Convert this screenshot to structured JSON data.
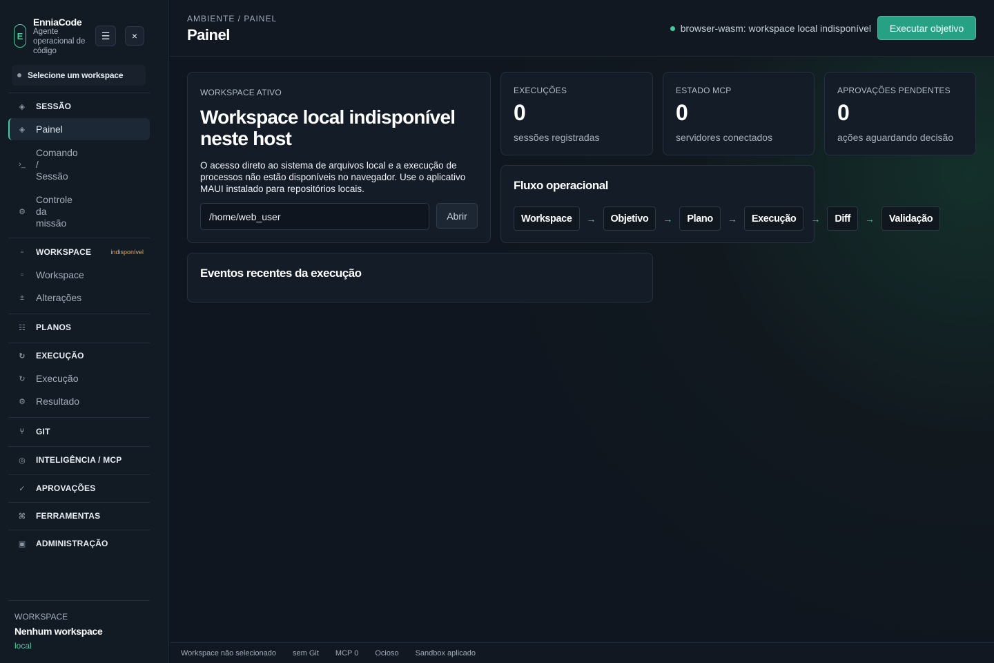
{
  "app": {
    "name": "EnniaCode",
    "logo_letter": "E",
    "tagline": "Agente operacional de código",
    "menu_icon": "☰",
    "close_icon": "×"
  },
  "sidebar": {
    "workspace_select": "Selecione um workspace",
    "sections": {
      "sessao": {
        "label": "SESSÃO",
        "icon": "diamond-icon"
      },
      "workspace": {
        "label": "WORKSPACE",
        "badge": "indisponível",
        "icon": "square-icon"
      },
      "planos": {
        "label": "PLANOS",
        "icon": "list-icon"
      },
      "execucao": {
        "label": "EXECUÇÃO",
        "icon": "refresh-icon"
      },
      "git": {
        "label": "GIT",
        "icon": "branch-icon"
      },
      "inteligencia": {
        "label": "INTELIGÊNCIA / MCP",
        "icon": "target-icon"
      },
      "aprovacoes": {
        "label": "APROVAÇÕES",
        "icon": "check-icon"
      },
      "ferramentas": {
        "label": "FERRAMENTAS",
        "icon": "command-icon"
      },
      "administracao": {
        "label": "ADMINISTRAÇÃO",
        "icon": "box-icon"
      }
    },
    "items": {
      "painel": "Painel",
      "comando_1": "Comando",
      "comando_2": "/",
      "comando_3": "Sessão",
      "controle_1": "Controle",
      "controle_2": "da",
      "controle_3": "missão",
      "workspace": "Workspace",
      "alteracoes": "Alterações",
      "execucao": "Execução",
      "resultado": "Resultado"
    },
    "footer": {
      "label": "WORKSPACE",
      "title": "Nenhum workspace",
      "sub": "local"
    }
  },
  "header": {
    "breadcrumb": "AMBIENTE / PAINEL",
    "title": "Painel",
    "status": "browser-wasm: workspace local indisponível",
    "primary_button": "Executar objetivo"
  },
  "workspace_card": {
    "label": "WORKSPACE ATIVO",
    "title": "Workspace local indisponível neste host",
    "description": "O acesso direto ao sistema de arquivos local e a execução de processos não estão disponíveis no navegador. Use o aplicativo MAUI instalado para repositórios locais.",
    "path_value": "/home/web_user",
    "open_button": "Abrir"
  },
  "stats": [
    {
      "label": "EXECUÇÕES",
      "value": "0",
      "sub": "sessões registradas"
    },
    {
      "label": "ESTADO MCP",
      "value": "0",
      "sub": "servidores conectados"
    },
    {
      "label": "APROVAÇÕES PENDENTES",
      "value": "0",
      "sub": "ações aguardando decisão"
    }
  ],
  "flow": {
    "title": "Fluxo operacional",
    "steps": [
      "Workspace",
      "Objetivo",
      "Plano",
      "Execução",
      "Diff",
      "Validação"
    ],
    "arrow": "→"
  },
  "events": {
    "title": "Eventos recentes da execução"
  },
  "statusbar": [
    "Workspace não selecionado",
    "sem Git",
    "MCP 0",
    "Ocioso",
    "Sandbox aplicado"
  ],
  "colors": {
    "accent": "#3fcf9f",
    "primary_button": "#27a184",
    "warning": "#f0a63a",
    "background": "#10161f"
  }
}
